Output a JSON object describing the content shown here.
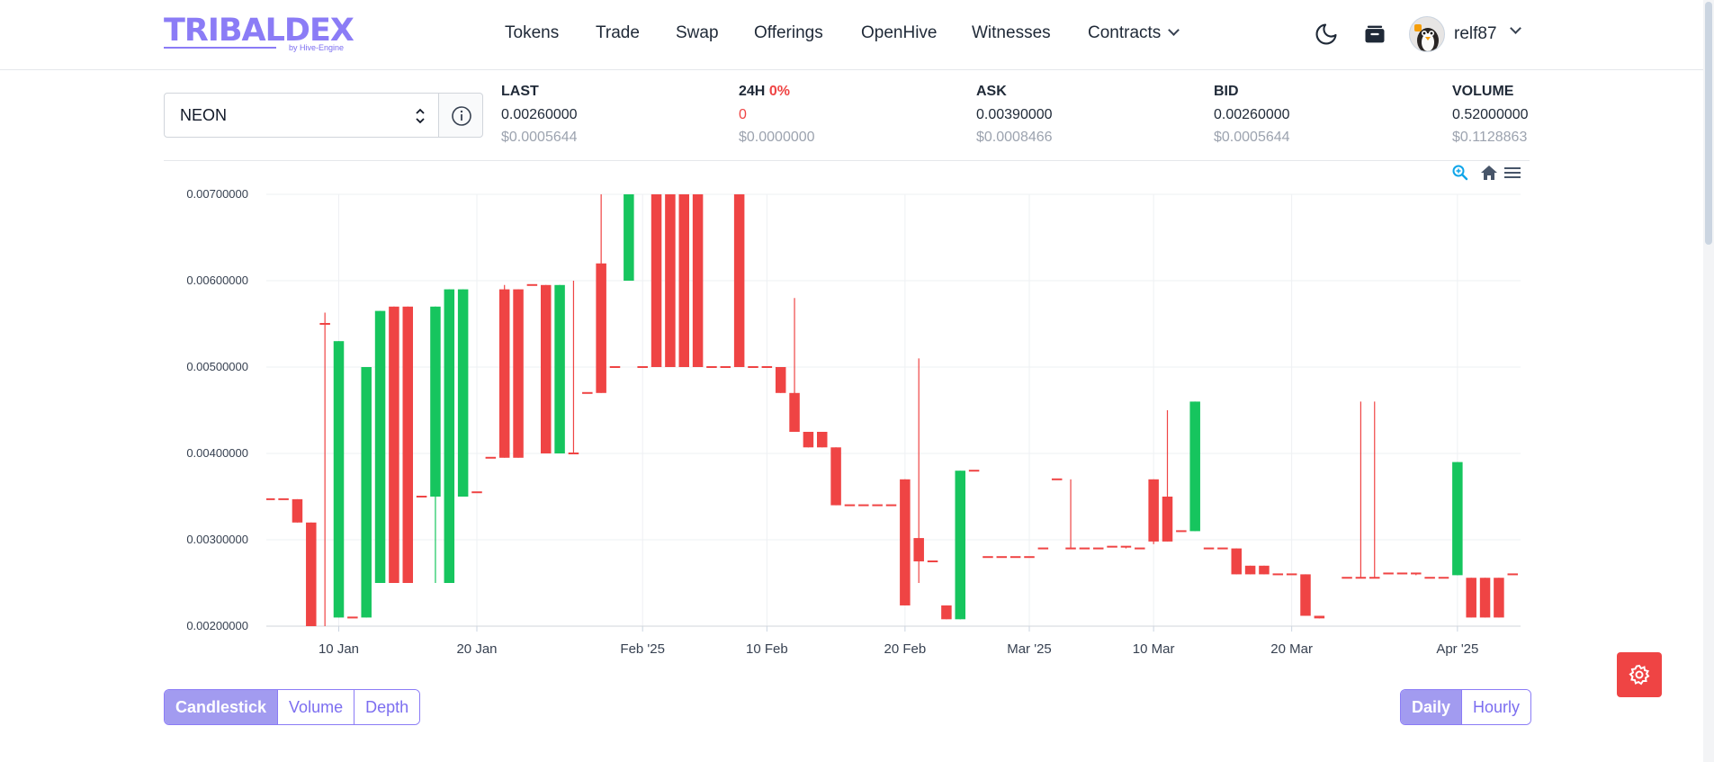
{
  "brand": {
    "name": "TRIBALDEX",
    "sub": "by Hive-Engine"
  },
  "nav": {
    "items": [
      "Tokens",
      "Trade",
      "Swap",
      "Offerings",
      "OpenHive",
      "Witnesses",
      "Contracts"
    ]
  },
  "user": {
    "name": "relf87"
  },
  "token": {
    "selected": "NEON"
  },
  "stats": {
    "last": {
      "label": "LAST",
      "value": "0.00260000",
      "usd": "$0.0005644"
    },
    "change": {
      "label": "24H",
      "pct": "0%",
      "value": "0",
      "usd": "$0.0000000"
    },
    "ask": {
      "label": "ASK",
      "value": "0.00390000",
      "usd": "$0.0008466"
    },
    "bid": {
      "label": "BID",
      "value": "0.00260000",
      "usd": "$0.0005644"
    },
    "volume": {
      "label": "VOLUME",
      "value": "0.52000000",
      "usd": "$0.1128863"
    }
  },
  "chart_tabs": [
    "Candlestick",
    "Volume",
    "Depth"
  ],
  "chart_tabs_active": "Candlestick",
  "interval_tabs": [
    "Daily",
    "Hourly"
  ],
  "interval_tabs_active": "Daily",
  "colors": {
    "up": "#16c55e",
    "down": "#ef4444",
    "accent": "#8b7cf6"
  },
  "chart_data": {
    "type": "candlestick",
    "y_ticks": [
      "0.00700000",
      "0.00600000",
      "0.00500000",
      "0.00400000",
      "0.00300000",
      "0.00200000"
    ],
    "ylim": [
      0.002,
      0.007
    ],
    "x_ticks": [
      {
        "label": "10 Jan",
        "day": 10
      },
      {
        "label": "20 Jan",
        "day": 20
      },
      {
        "label": "Feb '25",
        "day": 32
      },
      {
        "label": "10 Feb",
        "day": 41
      },
      {
        "label": "20 Feb",
        "day": 51
      },
      {
        "label": "Mar '25",
        "day": 60
      },
      {
        "label": "10 Mar",
        "day": 69
      },
      {
        "label": "20 Mar",
        "day": 79
      },
      {
        "label": "Apr '25",
        "day": 91
      }
    ],
    "candles": [
      {
        "d": 5,
        "o": 0.00347,
        "h": 0.00347,
        "l": 0.00347,
        "c": 0.00347
      },
      {
        "d": 6,
        "o": 0.00347,
        "h": 0.00347,
        "l": 0.00347,
        "c": 0.00347
      },
      {
        "d": 7,
        "o": 0.00347,
        "h": 0.00347,
        "l": 0.0032,
        "c": 0.0032
      },
      {
        "d": 8,
        "o": 0.0032,
        "h": 0.0032,
        "l": 0.002,
        "c": 0.002
      },
      {
        "d": 9,
        "o": 0.0055,
        "h": 0.00563,
        "l": 0.002,
        "c": 0.0055
      },
      {
        "d": 10,
        "o": 0.0021,
        "h": 0.0053,
        "l": 0.0021,
        "c": 0.0053
      },
      {
        "d": 11,
        "o": 0.0021,
        "h": 0.0021,
        "l": 0.0021,
        "c": 0.0021
      },
      {
        "d": 12,
        "o": 0.0021,
        "h": 0.005,
        "l": 0.0021,
        "c": 0.005
      },
      {
        "d": 13,
        "o": 0.0025,
        "h": 0.00565,
        "l": 0.0025,
        "c": 0.00565
      },
      {
        "d": 14,
        "o": 0.0057,
        "h": 0.0057,
        "l": 0.0025,
        "c": 0.0025
      },
      {
        "d": 15,
        "o": 0.0057,
        "h": 0.0057,
        "l": 0.0025,
        "c": 0.0025
      },
      {
        "d": 16,
        "o": 0.0035,
        "h": 0.0035,
        "l": 0.0035,
        "c": 0.0035
      },
      {
        "d": 17,
        "o": 0.0035,
        "h": 0.0057,
        "l": 0.0025,
        "c": 0.0057
      },
      {
        "d": 18,
        "o": 0.0025,
        "h": 0.0059,
        "l": 0.0025,
        "c": 0.0059
      },
      {
        "d": 19,
        "o": 0.0035,
        "h": 0.0059,
        "l": 0.0035,
        "c": 0.0059
      },
      {
        "d": 20,
        "o": 0.00355,
        "h": 0.00355,
        "l": 0.00355,
        "c": 0.00355
      },
      {
        "d": 21,
        "o": 0.00395,
        "h": 0.00395,
        "l": 0.00395,
        "c": 0.00395
      },
      {
        "d": 22,
        "o": 0.0059,
        "h": 0.00595,
        "l": 0.00395,
        "c": 0.00395
      },
      {
        "d": 23,
        "o": 0.0059,
        "h": 0.0059,
        "l": 0.00395,
        "c": 0.00395
      },
      {
        "d": 24,
        "o": 0.00595,
        "h": 0.00595,
        "l": 0.00595,
        "c": 0.00595
      },
      {
        "d": 25,
        "o": 0.00595,
        "h": 0.00595,
        "l": 0.004,
        "c": 0.004
      },
      {
        "d": 26,
        "o": 0.004,
        "h": 0.00595,
        "l": 0.004,
        "c": 0.00595
      },
      {
        "d": 27,
        "o": 0.004,
        "h": 0.006,
        "l": 0.004,
        "c": 0.004
      },
      {
        "d": 28,
        "o": 0.0047,
        "h": 0.0047,
        "l": 0.0047,
        "c": 0.0047
      },
      {
        "d": 29,
        "o": 0.0062,
        "h": 0.007,
        "l": 0.0047,
        "c": 0.0047
      },
      {
        "d": 30,
        "o": 0.005,
        "h": 0.005,
        "l": 0.005,
        "c": 0.005
      },
      {
        "d": 31,
        "o": 0.006,
        "h": 0.007,
        "l": 0.006,
        "c": 0.007
      },
      {
        "d": 32,
        "o": 0.005,
        "h": 0.005,
        "l": 0.005,
        "c": 0.005
      },
      {
        "d": 33,
        "o": 0.007,
        "h": 0.007,
        "l": 0.005,
        "c": 0.005
      },
      {
        "d": 34,
        "o": 0.007,
        "h": 0.007,
        "l": 0.005,
        "c": 0.005
      },
      {
        "d": 35,
        "o": 0.007,
        "h": 0.007,
        "l": 0.005,
        "c": 0.005
      },
      {
        "d": 36,
        "o": 0.007,
        "h": 0.007,
        "l": 0.005,
        "c": 0.005
      },
      {
        "d": 37,
        "o": 0.005,
        "h": 0.005,
        "l": 0.005,
        "c": 0.005
      },
      {
        "d": 38,
        "o": 0.005,
        "h": 0.005,
        "l": 0.005,
        "c": 0.005
      },
      {
        "d": 39,
        "o": 0.007,
        "h": 0.007,
        "l": 0.005,
        "c": 0.005
      },
      {
        "d": 40,
        "o": 0.005,
        "h": 0.005,
        "l": 0.005,
        "c": 0.005
      },
      {
        "d": 41,
        "o": 0.005,
        "h": 0.005,
        "l": 0.005,
        "c": 0.005
      },
      {
        "d": 42,
        "o": 0.005,
        "h": 0.005,
        "l": 0.0047,
        "c": 0.0047
      },
      {
        "d": 43,
        "o": 0.0047,
        "h": 0.0058,
        "l": 0.00425,
        "c": 0.00425
      },
      {
        "d": 44,
        "o": 0.00425,
        "h": 0.00425,
        "l": 0.00407,
        "c": 0.00407
      },
      {
        "d": 45,
        "o": 0.00425,
        "h": 0.00425,
        "l": 0.00407,
        "c": 0.00407
      },
      {
        "d": 46,
        "o": 0.00407,
        "h": 0.00407,
        "l": 0.0034,
        "c": 0.0034
      },
      {
        "d": 47,
        "o": 0.0034,
        "h": 0.0034,
        "l": 0.0034,
        "c": 0.0034
      },
      {
        "d": 48,
        "o": 0.0034,
        "h": 0.0034,
        "l": 0.0034,
        "c": 0.0034
      },
      {
        "d": 49,
        "o": 0.0034,
        "h": 0.0034,
        "l": 0.0034,
        "c": 0.0034
      },
      {
        "d": 50,
        "o": 0.0034,
        "h": 0.0034,
        "l": 0.0034,
        "c": 0.0034
      },
      {
        "d": 51,
        "o": 0.0037,
        "h": 0.0037,
        "l": 0.00224,
        "c": 0.00224
      },
      {
        "d": 52,
        "o": 0.00302,
        "h": 0.0051,
        "l": 0.0025,
        "c": 0.00275
      },
      {
        "d": 53,
        "o": 0.00275,
        "h": 0.00275,
        "l": 0.00275,
        "c": 0.00275
      },
      {
        "d": 54,
        "o": 0.00224,
        "h": 0.00224,
        "l": 0.00208,
        "c": 0.00208
      },
      {
        "d": 55,
        "o": 0.00208,
        "h": 0.0038,
        "l": 0.00208,
        "c": 0.0038
      },
      {
        "d": 56,
        "o": 0.0038,
        "h": 0.0038,
        "l": 0.0038,
        "c": 0.0038
      },
      {
        "d": 57,
        "o": 0.0028,
        "h": 0.0028,
        "l": 0.0028,
        "c": 0.0028
      },
      {
        "d": 58,
        "o": 0.0028,
        "h": 0.0028,
        "l": 0.0028,
        "c": 0.0028
      },
      {
        "d": 59,
        "o": 0.0028,
        "h": 0.0028,
        "l": 0.0028,
        "c": 0.0028
      },
      {
        "d": 60,
        "o": 0.0028,
        "h": 0.0028,
        "l": 0.0028,
        "c": 0.0028
      },
      {
        "d": 61,
        "o": 0.0029,
        "h": 0.0029,
        "l": 0.0029,
        "c": 0.0029
      },
      {
        "d": 62,
        "o": 0.0037,
        "h": 0.0037,
        "l": 0.0037,
        "c": 0.0037
      },
      {
        "d": 63,
        "o": 0.0029,
        "h": 0.0037,
        "l": 0.0029,
        "c": 0.0029
      },
      {
        "d": 64,
        "o": 0.0029,
        "h": 0.0029,
        "l": 0.0029,
        "c": 0.0029
      },
      {
        "d": 65,
        "o": 0.0029,
        "h": 0.0029,
        "l": 0.0029,
        "c": 0.0029
      },
      {
        "d": 66,
        "o": 0.00292,
        "h": 0.00292,
        "l": 0.00292,
        "c": 0.00292
      },
      {
        "d": 67,
        "o": 0.00292,
        "h": 0.00292,
        "l": 0.0029,
        "c": 0.0029
      },
      {
        "d": 68,
        "o": 0.0029,
        "h": 0.0029,
        "l": 0.0029,
        "c": 0.0029
      },
      {
        "d": 69,
        "o": 0.0037,
        "h": 0.0037,
        "l": 0.00295,
        "c": 0.00298
      },
      {
        "d": 70,
        "o": 0.0035,
        "h": 0.0045,
        "l": 0.00298,
        "c": 0.00298
      },
      {
        "d": 71,
        "o": 0.0031,
        "h": 0.0031,
        "l": 0.0031,
        "c": 0.0031
      },
      {
        "d": 72,
        "o": 0.0031,
        "h": 0.0046,
        "l": 0.0031,
        "c": 0.0046
      },
      {
        "d": 73,
        "o": 0.0029,
        "h": 0.0029,
        "l": 0.0029,
        "c": 0.0029
      },
      {
        "d": 74,
        "o": 0.0029,
        "h": 0.0029,
        "l": 0.0029,
        "c": 0.0029
      },
      {
        "d": 75,
        "o": 0.0029,
        "h": 0.0029,
        "l": 0.0026,
        "c": 0.0026
      },
      {
        "d": 76,
        "o": 0.0027,
        "h": 0.0027,
        "l": 0.0026,
        "c": 0.0026
      },
      {
        "d": 77,
        "o": 0.0027,
        "h": 0.0027,
        "l": 0.0026,
        "c": 0.0026
      },
      {
        "d": 78,
        "o": 0.0026,
        "h": 0.0026,
        "l": 0.0026,
        "c": 0.0026
      },
      {
        "d": 79,
        "o": 0.0026,
        "h": 0.0026,
        "l": 0.0026,
        "c": 0.0026
      },
      {
        "d": 80,
        "o": 0.0026,
        "h": 0.0026,
        "l": 0.00212,
        "c": 0.00212
      },
      {
        "d": 81,
        "o": 0.00212,
        "h": 0.00212,
        "l": 0.00209,
        "c": 0.00209
      },
      {
        "d": 83,
        "o": 0.00256,
        "h": 0.00256,
        "l": 0.00256,
        "c": 0.00256
      },
      {
        "d": 84,
        "o": 0.00256,
        "h": 0.0046,
        "l": 0.00256,
        "c": 0.00256
      },
      {
        "d": 85,
        "o": 0.00256,
        "h": 0.0046,
        "l": 0.00256,
        "c": 0.00256
      },
      {
        "d": 86,
        "o": 0.00261,
        "h": 0.00261,
        "l": 0.00261,
        "c": 0.00261
      },
      {
        "d": 87,
        "o": 0.00261,
        "h": 0.00261,
        "l": 0.00261,
        "c": 0.00261
      },
      {
        "d": 88,
        "o": 0.00261,
        "h": 0.00261,
        "l": 0.00259,
        "c": 0.00259
      },
      {
        "d": 89,
        "o": 0.00256,
        "h": 0.00256,
        "l": 0.00256,
        "c": 0.00256
      },
      {
        "d": 90,
        "o": 0.00256,
        "h": 0.00256,
        "l": 0.00256,
        "c": 0.00256
      },
      {
        "d": 91,
        "o": 0.00259,
        "h": 0.0039,
        "l": 0.00259,
        "c": 0.0039
      },
      {
        "d": 92,
        "o": 0.00256,
        "h": 0.00256,
        "l": 0.0021,
        "c": 0.0021
      },
      {
        "d": 93,
        "o": 0.00256,
        "h": 0.00256,
        "l": 0.0021,
        "c": 0.0021
      },
      {
        "d": 94,
        "o": 0.00256,
        "h": 0.00256,
        "l": 0.0021,
        "c": 0.0021
      },
      {
        "d": 95,
        "o": 0.0026,
        "h": 0.0026,
        "l": 0.0026,
        "c": 0.0026
      }
    ]
  }
}
